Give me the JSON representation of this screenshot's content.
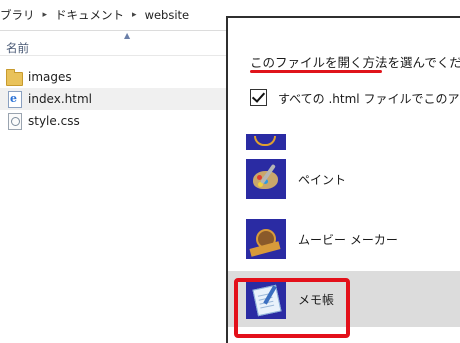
{
  "breadcrumb": {
    "items": [
      "ブラリ",
      "ドキュメント",
      "website"
    ],
    "separator": "▸"
  },
  "file_list": {
    "column_header": "名前",
    "sort_indicator": "▲",
    "files": [
      {
        "name": "images",
        "icon": "folder-icon"
      },
      {
        "name": "index.html",
        "icon": "html-file-icon"
      },
      {
        "name": "style.css",
        "icon": "css-file-icon"
      }
    ]
  },
  "dialog": {
    "title": "このファイルを開く方法を選んでくださ",
    "checkbox_label": "すべての .html ファイルでこのアプ",
    "checkbox_checked": true,
    "apps": [
      {
        "label": "ペイント",
        "icon": "paint-icon"
      },
      {
        "label": "ムービー メーカー",
        "icon": "movie-maker-icon"
      },
      {
        "label": "メモ帳",
        "icon": "notepad-icon"
      }
    ]
  },
  "colors": {
    "accent_red": "#e3101a",
    "app_tile": "#2a2ba3",
    "hover_row": "#dcdcdc"
  }
}
